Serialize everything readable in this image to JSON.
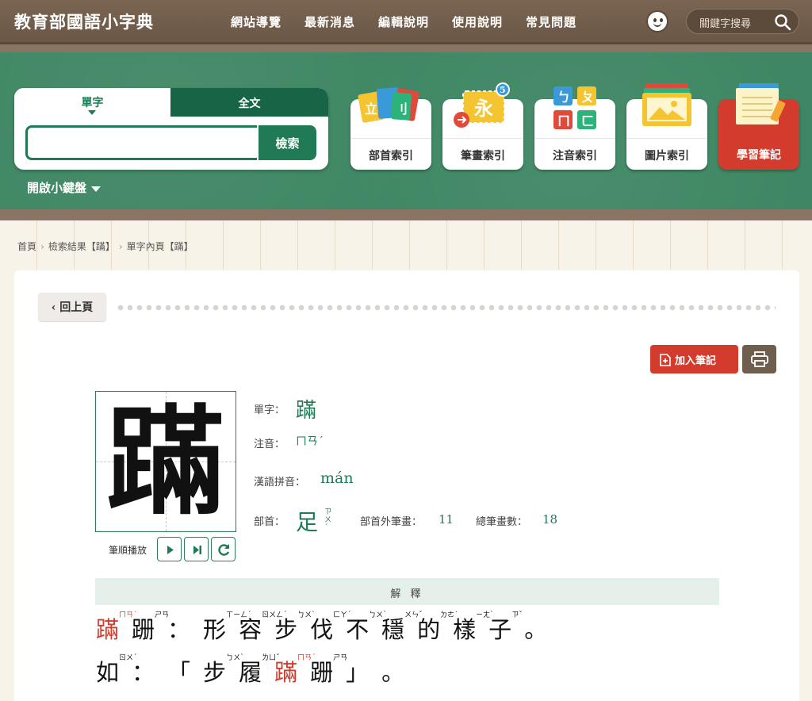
{
  "header": {
    "site_title": "教育部國語小字典",
    "nav": [
      "網站導覽",
      "最新消息",
      "編輯說明",
      "使用說明",
      "常見問題"
    ],
    "search_placeholder": "關鍵字搜尋"
  },
  "search": {
    "tabs": [
      "單字",
      "全文"
    ],
    "button_label": "檢索",
    "input_value": "",
    "keyboard_toggle": "開啟小鍵盤"
  },
  "index_cards": [
    "部首索引",
    "筆畫索引",
    "注音索引",
    "圖片索引",
    "學習筆記"
  ],
  "index_icon_badge": "5",
  "breadcrumb": [
    "首頁",
    "檢索結果【蹣】",
    "單字內頁【蹣】"
  ],
  "content": {
    "back_label": "回上頁",
    "add_note_label": "加入筆記",
    "character": "蹣",
    "stroke_order_label": "筆順播放",
    "labels": {
      "char": "單字：",
      "zhuyin": "注音：",
      "pinyin": "漢語拼音：",
      "radical": "部首：",
      "strokes_outside": "部首外筆畫：",
      "total_strokes": "總筆畫數："
    },
    "values": {
      "char": "蹣",
      "zhuyin": "ㄇㄢˊ",
      "pinyin": "mán",
      "radical": "足",
      "radical_zhuyin": "ㄗㄨˊ",
      "strokes_outside": "11",
      "total_strokes": "18"
    },
    "explain_heading": "解 釋",
    "definition_line1": [
      {
        "t": "蹣",
        "z": "ㄇㄢˊ",
        "hl": true
      },
      {
        "t": "跚",
        "z": "ㄕㄢ"
      },
      {
        "t": "：",
        "z": ""
      },
      {
        "t": "形",
        "z": "ㄒㄧㄥˊ"
      },
      {
        "t": "容",
        "z": "ㄖㄨㄥˊ"
      },
      {
        "t": "步",
        "z": "ㄅㄨˋ"
      },
      {
        "t": "伐",
        "z": "ㄈㄚˊ"
      },
      {
        "t": "不",
        "z": "ㄅㄨˋ"
      },
      {
        "t": "穩",
        "z": "ㄨㄣˇ"
      },
      {
        "t": "的",
        "z": "ㄉㄜ˙"
      },
      {
        "t": "樣",
        "z": "ㄧㄤˋ"
      },
      {
        "t": "子",
        "z": "ㄗˇ"
      },
      {
        "t": "。",
        "z": ""
      }
    ],
    "definition_line2": [
      {
        "t": "如",
        "z": "ㄖㄨˊ"
      },
      {
        "t": "：",
        "z": ""
      },
      {
        "t": "「",
        "z": ""
      },
      {
        "t": "步",
        "z": "ㄅㄨˋ"
      },
      {
        "t": "履",
        "z": "ㄌㄩˇ"
      },
      {
        "t": "蹣",
        "z": "ㄇㄢˊ",
        "hl": true
      },
      {
        "t": "跚",
        "z": "ㄕㄢ"
      },
      {
        "t": "」",
        "z": ""
      },
      {
        "t": "。",
        "z": ""
      }
    ]
  },
  "colors": {
    "brand_green": "#1f7a55",
    "highlight_red": "#d33b2c",
    "chalkboard": "#3f8764",
    "header_brown": "#6b5746"
  }
}
